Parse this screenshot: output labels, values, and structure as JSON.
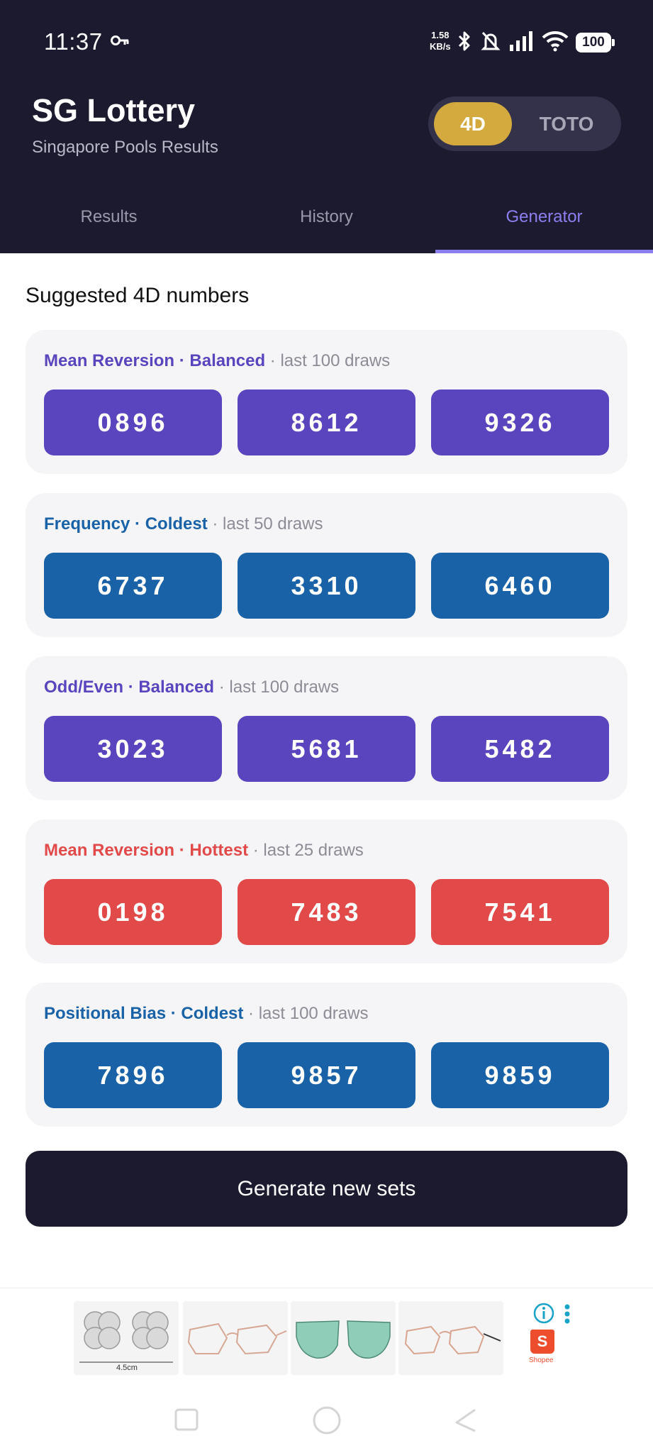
{
  "status_bar": {
    "time": "11:37",
    "speed_value": "1.58",
    "speed_unit": "KB/s",
    "battery": "100",
    "icons": [
      "key-icon",
      "bluetooth-icon",
      "bell-muted-icon",
      "signal-icon",
      "wifi-icon",
      "battery-icon"
    ]
  },
  "header": {
    "title": "SG Lottery",
    "subtitle": "Singapore Pools Results",
    "mode_toggle": {
      "options": [
        "4D",
        "TOTO"
      ],
      "selected": "4D"
    }
  },
  "tabs": [
    {
      "label": "Results",
      "active": false
    },
    {
      "label": "History",
      "active": false
    },
    {
      "label": "Generator",
      "active": true
    }
  ],
  "main": {
    "section_title": "Suggested 4D numbers",
    "cards": [
      {
        "strategy": "Mean Reversion · Balanced",
        "meta": " · last 100 draws",
        "color": "#5b45bf",
        "numbers": [
          "0896",
          "8612",
          "9326"
        ]
      },
      {
        "strategy": "Frequency · Coldest",
        "meta": " · last 50 draws",
        "color": "#1a62a8",
        "numbers": [
          "6737",
          "3310",
          "6460"
        ]
      },
      {
        "strategy": "Odd/Even · Balanced",
        "meta": " · last 100 draws",
        "color": "#5b45bf",
        "numbers": [
          "3023",
          "5681",
          "5482"
        ]
      },
      {
        "strategy": "Mean Reversion · Hottest",
        "meta": " · last 25 draws",
        "color": "#e24a4a",
        "numbers": [
          "0198",
          "7483",
          "7541"
        ]
      },
      {
        "strategy": "Positional Bias · Coldest",
        "meta": " · last 100 draws",
        "color": "#1a62a8",
        "numbers": [
          "7896",
          "9857",
          "9859"
        ]
      }
    ],
    "generate_button": "Generate new sets"
  },
  "ad": {
    "size_label": "4.5cm",
    "brand_label": "Shopee",
    "brand_letter": "S",
    "items": [
      "earrings-image",
      "glasses-image",
      "sunglasses-image",
      "glasses-image"
    ]
  },
  "nav_bar": {
    "icons": [
      "recent-apps-icon",
      "home-icon",
      "back-icon"
    ]
  }
}
